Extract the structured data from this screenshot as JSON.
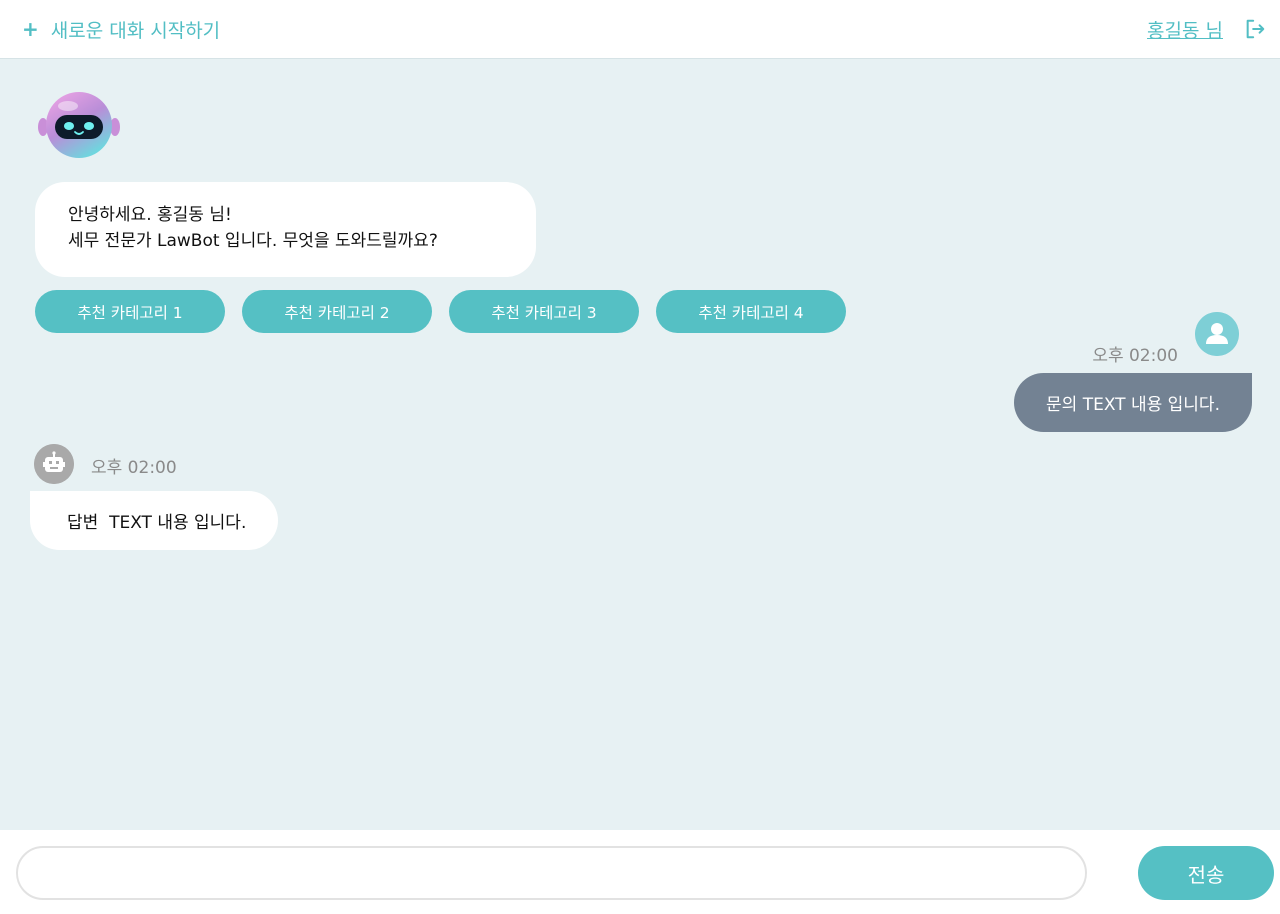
{
  "header": {
    "new_chat_icon": "+",
    "new_chat_label": "새로운 대화 시작하기",
    "user_name": "홍길동 님",
    "logout_icon": "logout-icon"
  },
  "greeting": {
    "line1": "안녕하세요. 홍길동 님!",
    "line2": "세무 전문가 LawBot 입니다. 무엇을 도와드릴까요?"
  },
  "chips": [
    {
      "label": "추천 카테고리 1"
    },
    {
      "label": "추천 카테고리 2"
    },
    {
      "label": "추천 카테고리 3"
    },
    {
      "label": "추천 카테고리 4"
    }
  ],
  "user_message": {
    "time": "오후 02:00",
    "text": "문의 TEXT 내용 입니다."
  },
  "bot_message": {
    "time": "오후 02:00",
    "text": "답변  TEXT 내용 입니다."
  },
  "composer": {
    "input_value": "",
    "input_placeholder": "",
    "send_label": "전송"
  },
  "colors": {
    "accent": "#55c0c4",
    "background": "#e7f1f3",
    "user_bubble": "#738293"
  }
}
